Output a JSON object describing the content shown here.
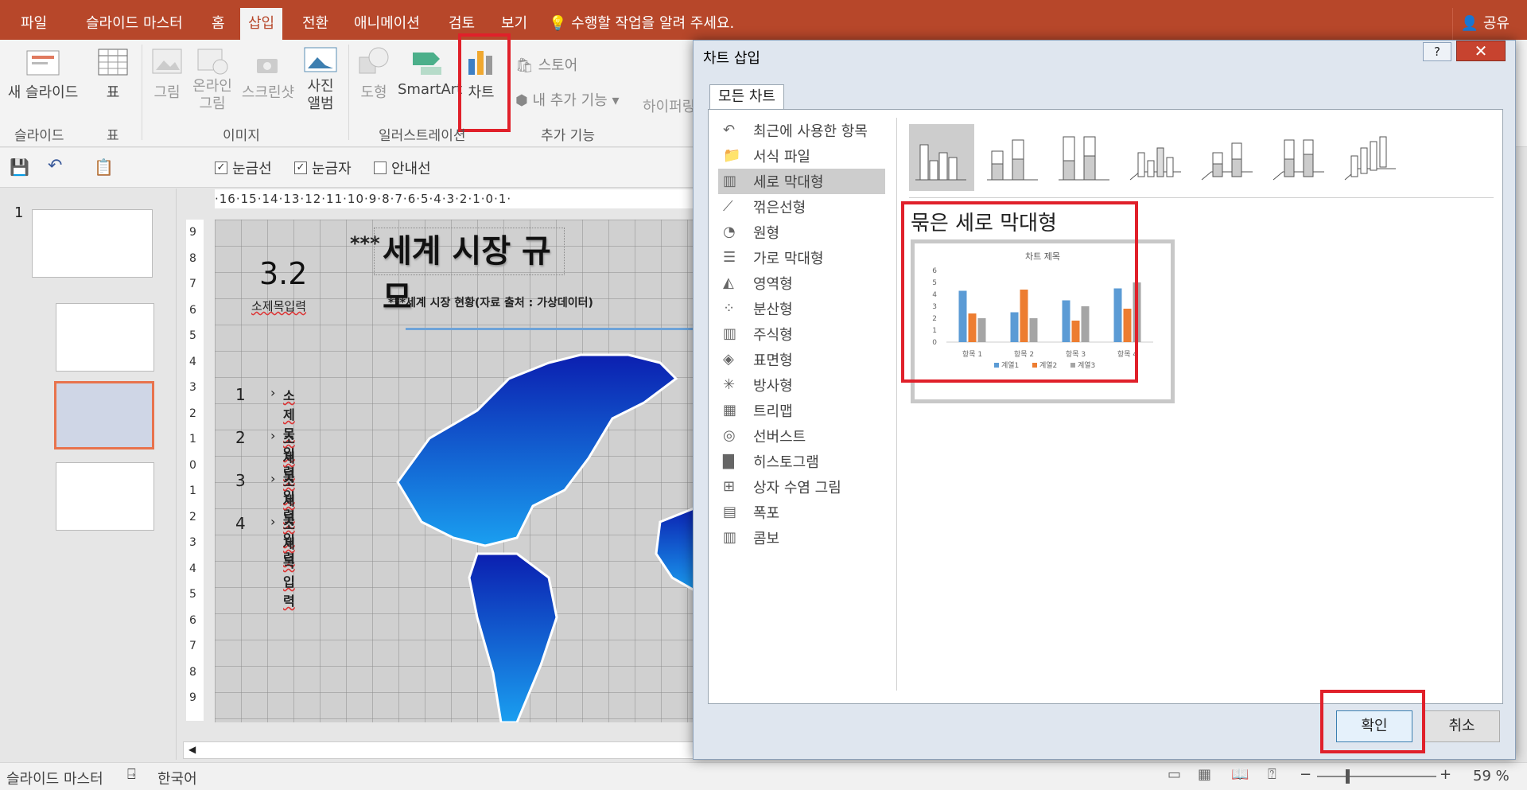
{
  "ribbon_tabs": [
    "파일",
    "슬라이드 마스터",
    "홈",
    "삽입",
    "전환",
    "애니메이션",
    "검토",
    "보기"
  ],
  "tell_me": "수행할 작업을 알려 주세요.",
  "share": "공유",
  "ribbon": {
    "new_slide": "새 슬라이드",
    "table": "표",
    "picture": "그림",
    "online_picture": "온라인 그림",
    "screenshot": "스크린샷",
    "photo_album": "사진 앨범",
    "shapes": "도형",
    "smartart": "SmartArt",
    "chart": "차트",
    "store": "스토어",
    "my_addins": "내 추가 기능",
    "hyperlink": "하이퍼링",
    "group_slides": "슬라이드",
    "group_table": "표",
    "group_images": "이미지",
    "group_illustrations": "일러스트레이션",
    "group_addins": "추가 기능"
  },
  "qat": {
    "gridlines": "눈금선",
    "ruler": "눈금자",
    "guides": "안내선"
  },
  "slide_number": "1",
  "ruler_text": "·16·15·14·13·12·11·10·9·8·7·6·5·4·3·2·1·0·1·",
  "vruler_labels": [
    "9",
    "8",
    "7",
    "6",
    "5",
    "4",
    "3",
    "2",
    "1",
    "0",
    "1",
    "2",
    "3",
    "4",
    "5",
    "6",
    "7",
    "8",
    "9"
  ],
  "slide": {
    "stars": "***",
    "title": "세계 시장 규모",
    "big_number": "3.2",
    "subtitle_label": "소제목입력",
    "source_line": "***세계 시장 현황(자료 출처 : 가상데이터)",
    "items": [
      {
        "num": "1",
        "text": "소제목입력"
      },
      {
        "num": "2",
        "text": "소제목입력"
      },
      {
        "num": "3",
        "text": "소제목입력"
      },
      {
        "num": "4",
        "text": "소제목입력"
      }
    ]
  },
  "status": {
    "view": "슬라이드 마스터",
    "language": "한국어",
    "zoom": "59 %"
  },
  "dialog": {
    "title": "차트 삽입",
    "help": "?",
    "close": "✕",
    "tab": "모든 차트",
    "categories": [
      "최근에 사용한 항목",
      "서식 파일",
      "세로 막대형",
      "꺾은선형",
      "원형",
      "가로 막대형",
      "영역형",
      "분산형",
      "주식형",
      "표면형",
      "방사형",
      "트리맵",
      "선버스트",
      "히스토그램",
      "상자 수염 그림",
      "폭포",
      "콤보"
    ],
    "selected_category_index": 2,
    "preview_title": "묶은 세로 막대형",
    "ok": "확인",
    "cancel": "취소"
  },
  "chart_data": {
    "type": "bar",
    "title": "차트 제목",
    "categories": [
      "항목 1",
      "항목 2",
      "항목 3",
      "항목 4"
    ],
    "series": [
      {
        "name": "계열1",
        "values": [
          4.3,
          2.5,
          3.5,
          4.5
        ],
        "color": "#5b9bd5"
      },
      {
        "name": "계열2",
        "values": [
          2.4,
          4.4,
          1.8,
          2.8
        ],
        "color": "#ed7d31"
      },
      {
        "name": "계열3",
        "values": [
          2,
          2,
          3,
          5
        ],
        "color": "#a5a5a5"
      }
    ],
    "ylim": [
      0,
      6
    ],
    "yticks": [
      "0",
      "1",
      "2",
      "3",
      "4",
      "5",
      "6"
    ],
    "legend": "bottom",
    "grid": false
  },
  "colors": {
    "ribbon_bg": "#b7472a",
    "highlight": "#e0202a",
    "selected_thumb": "#e8734d",
    "map_blue": "#1736c9"
  }
}
